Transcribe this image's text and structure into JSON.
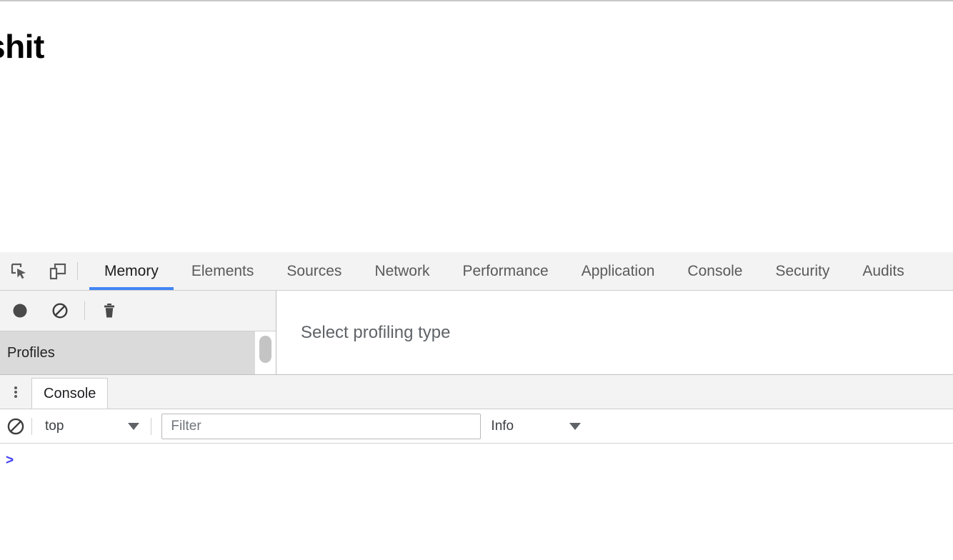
{
  "page": {
    "heading": "shit"
  },
  "devtools": {
    "toolbar_icons": [
      {
        "name": "inspect-element-icon",
        "title": "Inspect element"
      },
      {
        "name": "device-toolbar-icon",
        "title": "Toggle device toolbar"
      }
    ],
    "tabs": [
      {
        "label": "Memory",
        "active": true
      },
      {
        "label": "Elements",
        "active": false
      },
      {
        "label": "Sources",
        "active": false
      },
      {
        "label": "Network",
        "active": false
      },
      {
        "label": "Performance",
        "active": false
      },
      {
        "label": "Application",
        "active": false
      },
      {
        "label": "Console",
        "active": false
      },
      {
        "label": "Security",
        "active": false
      },
      {
        "label": "Audits",
        "active": false
      }
    ],
    "active_tab": "Memory",
    "accent_color": "#4285f4"
  },
  "memory_panel": {
    "toolbar_icons": [
      {
        "name": "record-icon",
        "title": "Start recording"
      },
      {
        "name": "clear-icon",
        "title": "Clear"
      },
      {
        "name": "trash-icon",
        "title": "Delete profile"
      }
    ],
    "sidebar": {
      "header_label": "Profiles",
      "has_scrollbar": true
    },
    "empty_state": "Select profiling type"
  },
  "drawer": {
    "menu_icon": "more-options-icon",
    "tabs": [
      {
        "label": "Console",
        "active": true
      }
    ],
    "console": {
      "clear_icon": "clear-console-icon",
      "context_selector": {
        "value": "top",
        "caret": "chevron-down-icon"
      },
      "filter": {
        "value": "",
        "placeholder": "Filter"
      },
      "level_selector": {
        "value": "Info",
        "caret": "chevron-down-icon"
      },
      "prompt_symbol": ">",
      "prompt_value": "",
      "messages": []
    }
  }
}
